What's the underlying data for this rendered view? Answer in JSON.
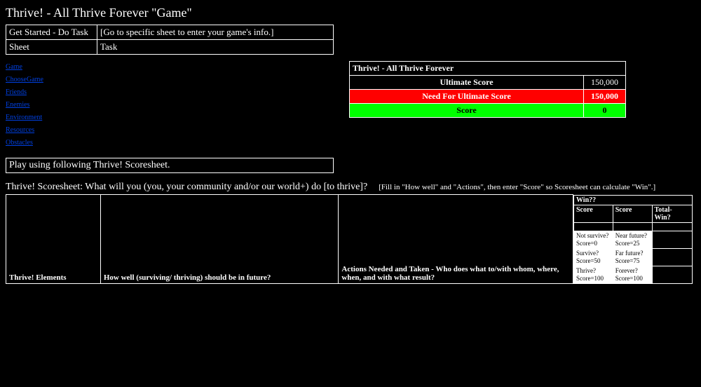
{
  "page_title": "Thrive! - All Thrive Forever \"Game\"",
  "get_started": {
    "heading": "Get Started - Do Task",
    "hint": "[Go to specific sheet to enter your game's info.]",
    "col_sheet": "Sheet",
    "col_task": "Task"
  },
  "sheets": [
    "Game",
    "ChooseGame",
    "Friends",
    "Enemies",
    "Environment",
    "Resources",
    "Obstacles"
  ],
  "scorebox": {
    "title": "Thrive! - All Thrive Forever",
    "ultimate_label": "Ultimate Score",
    "ultimate_value": "150,000",
    "need_label": "Need For Ultimate Score",
    "need_value": "150,000",
    "score_label": "Score",
    "score_value": "0"
  },
  "play_using": "Play using following Thrive! Scoresheet.",
  "scoresheet_q": "Thrive! Scoresheet: What will you (you, your community and/or our world+) do [to thrive]?",
  "fill_hint": "[Fill in \"How well\" and \"Actions\", then enter \"Score\" so Scoresheet can calculate \"Win\".]",
  "cols": {
    "elements": "Thrive! Elements",
    "howwell": "How well (surviving/ thriving) should be in future?",
    "actions": "Actions Needed and Taken   - Who does what to/with whom, where, when, and with what result?"
  },
  "win": {
    "q": "Win??",
    "score1": "Score",
    "score2": "Score",
    "total": "Total- Win?",
    "legend": [
      [
        "Not survive? Score=0",
        "Near future? Score=25"
      ],
      [
        "Survive? Score=50",
        "Far future? Score=75"
      ],
      [
        "Thrive? Score=100",
        "Forever? Score=100"
      ]
    ]
  }
}
